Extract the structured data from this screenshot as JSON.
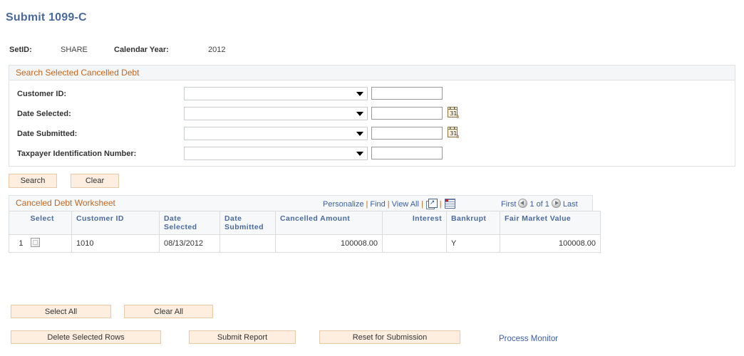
{
  "page": {
    "title": "Submit 1099-C"
  },
  "key_fields": [
    {
      "label": "SetID:",
      "value": "SHARE"
    },
    {
      "label": "Calendar Year:",
      "value": "2012"
    }
  ],
  "search_group": {
    "header": "Search Selected Cancelled Debt",
    "fields": [
      {
        "label": "Customer ID:",
        "operator": "",
        "value": "",
        "has_calendar": false
      },
      {
        "label": "Date Selected:",
        "operator": "",
        "value": "",
        "has_calendar": true
      },
      {
        "label": "Date Submitted:",
        "operator": "",
        "value": "",
        "has_calendar": true
      },
      {
        "label": "Taxpayer Identification Number:",
        "operator": "",
        "value": "",
        "has_calendar": false
      }
    ],
    "buttons": {
      "search": "Search",
      "clear": "Clear"
    }
  },
  "grid": {
    "title": "Canceled Debt Worksheet",
    "tools": {
      "personalize": "Personalize",
      "find": "Find",
      "view_all": "View All",
      "separator": "|",
      "expand_icon": "expand-grid-icon",
      "download_icon": "download-to-excel-icon"
    },
    "pager": {
      "first": "First",
      "prev_icon": "previous-page-icon",
      "count": "1 of 1",
      "next_icon": "next-page-icon",
      "last": "Last"
    },
    "columns": [
      "Select",
      "Customer ID",
      "Date Selected",
      "Date Submitted",
      "Cancelled Amount",
      "Interest",
      "Bankrupt",
      "Fair Market Value"
    ],
    "rows": [
      {
        "number": "1",
        "selected": false,
        "customer_id": "1010",
        "date_selected": "08/13/2012",
        "date_submitted": "",
        "cancelled_amount": "100008.00",
        "interest": "",
        "bankrupt": "Y",
        "fair_market_value": "100008.00"
      }
    ]
  },
  "actions": {
    "select_all": "Select All",
    "clear_all": "Clear All",
    "delete_selected_rows": "Delete Selected Rows",
    "submit_report": "Submit Report",
    "reset_for_submission": "Reset for Submission",
    "process_monitor": "Process Monitor"
  },
  "colors": {
    "title_blue": "#4a6a9c",
    "section_orange": "#c0661f",
    "button_fill": "#fdeedf",
    "button_border": "#e6c9a8",
    "link_blue": "#3a5f9e"
  }
}
